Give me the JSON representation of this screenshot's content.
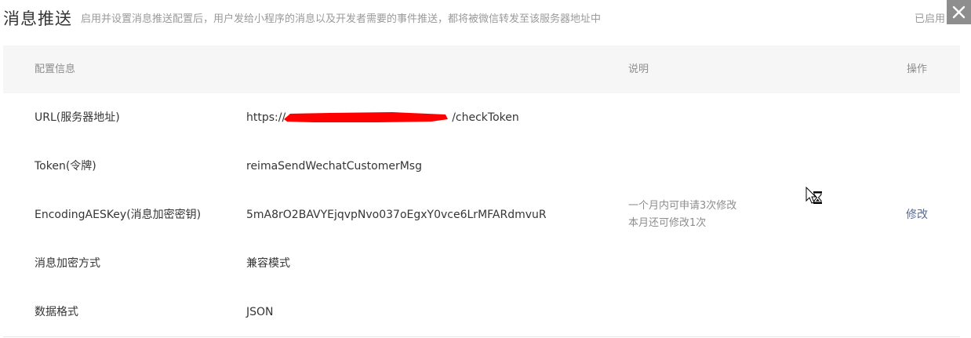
{
  "header": {
    "title": "消息推送",
    "subtitle": "启用并设置消息推送配置后，用户发给小程序的消息以及开发者需要的事件推送，都将被微信转发至该服务器地址中",
    "status": "已启用"
  },
  "table": {
    "columns": [
      "配置信息",
      "说明",
      "操作"
    ],
    "rows": [
      {
        "label": "URL(服务器地址)",
        "value_prefix": "https://",
        "value_suffix": "/checkToken"
      },
      {
        "label": "Token(令牌)",
        "value": "reimaSendWechatCustomerMsg"
      },
      {
        "label": "EncodingAESKey(消息加密密钥)",
        "value": "5mA8rO2BAVYEjqvpNvo037oEgxY0vce6LrMFARdmvuR",
        "note_line1": "一个月内可申请3次修改",
        "note_line2": "本月还可修改1次",
        "action": "修改"
      },
      {
        "label": "消息加密方式",
        "value": "兼容模式"
      },
      {
        "label": "数据格式",
        "value": "JSON"
      }
    ]
  },
  "colors": {
    "redaction": "#ff0000",
    "link": "#576b95",
    "header_bg": "#f6f6f6",
    "close_bg": "#8e8e8e"
  }
}
